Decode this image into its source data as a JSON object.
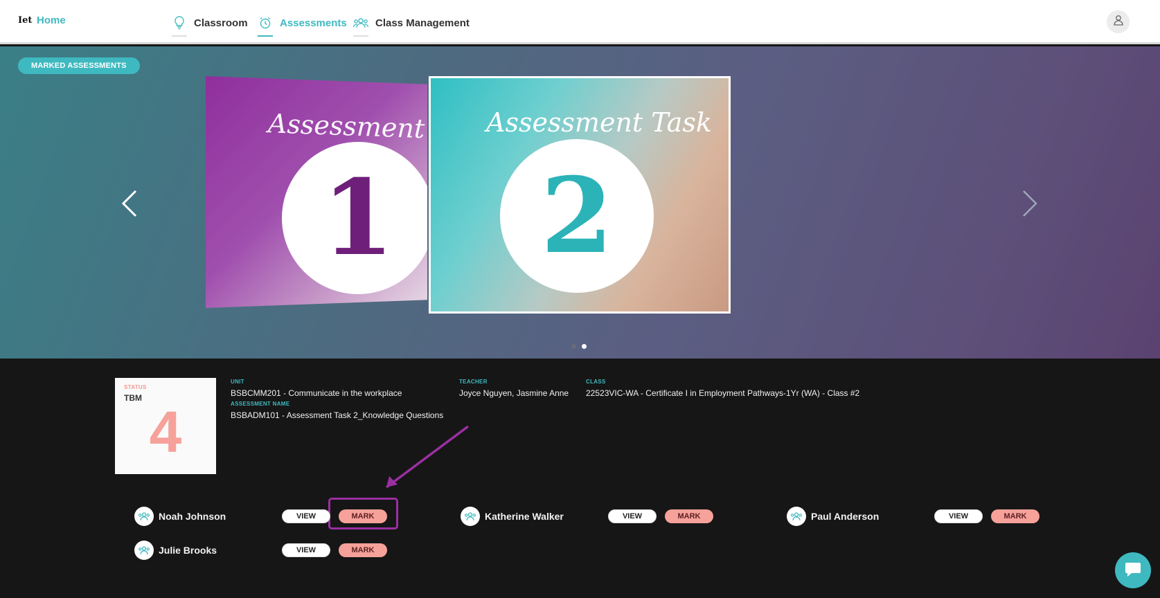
{
  "nav": {
    "logo_text": "Iet",
    "home_label": "Home",
    "items": [
      {
        "label": "Classroom",
        "icon": "lightbulb-icon",
        "active": false
      },
      {
        "label": "Assessments",
        "icon": "alarm-clock-icon",
        "active": true
      },
      {
        "label": "Class Management",
        "icon": "users-icon",
        "active": false
      }
    ],
    "profile_icon": "user-icon"
  },
  "hero": {
    "marked_button_label": "MARKED ASSESSMENTS",
    "cards": [
      {
        "title": "Assessment Task",
        "number": "1"
      },
      {
        "title": "Assessment Task",
        "number": "2"
      }
    ],
    "active_slide": 2,
    "slide_count": 2
  },
  "details": {
    "status_label": "STATUS",
    "status_value": "TBM",
    "status_count": "4",
    "unit_label": "UNIT",
    "unit_value": "BSBCMM201 - Communicate in the workplace",
    "assessment_label": "ASSESSMENT NAME",
    "assessment_value": "BSBADM101 - Assessment Task 2_Knowledge Questions",
    "teacher_label": "TEACHER",
    "teacher_value": "Joyce Nguyen, Jasmine Anne",
    "class_label": "CLASS",
    "class_value": "22523VIC-WA - Certificate I in Employment Pathways-1Yr (WA) - Class #2"
  },
  "students": [
    {
      "name": "Noah Johnson",
      "view_label": "VIEW",
      "mark_label": "MARK"
    },
    {
      "name": "Katherine Walker",
      "view_label": "VIEW",
      "mark_label": "MARK"
    },
    {
      "name": "Paul Anderson",
      "view_label": "VIEW",
      "mark_label": "MARK"
    },
    {
      "name": "Julie Brooks",
      "view_label": "VIEW",
      "mark_label": "MARK"
    }
  ],
  "colors": {
    "accent": "#3fb9c0",
    "mark": "#f6a19a",
    "annotation": "#9b2fa2"
  }
}
